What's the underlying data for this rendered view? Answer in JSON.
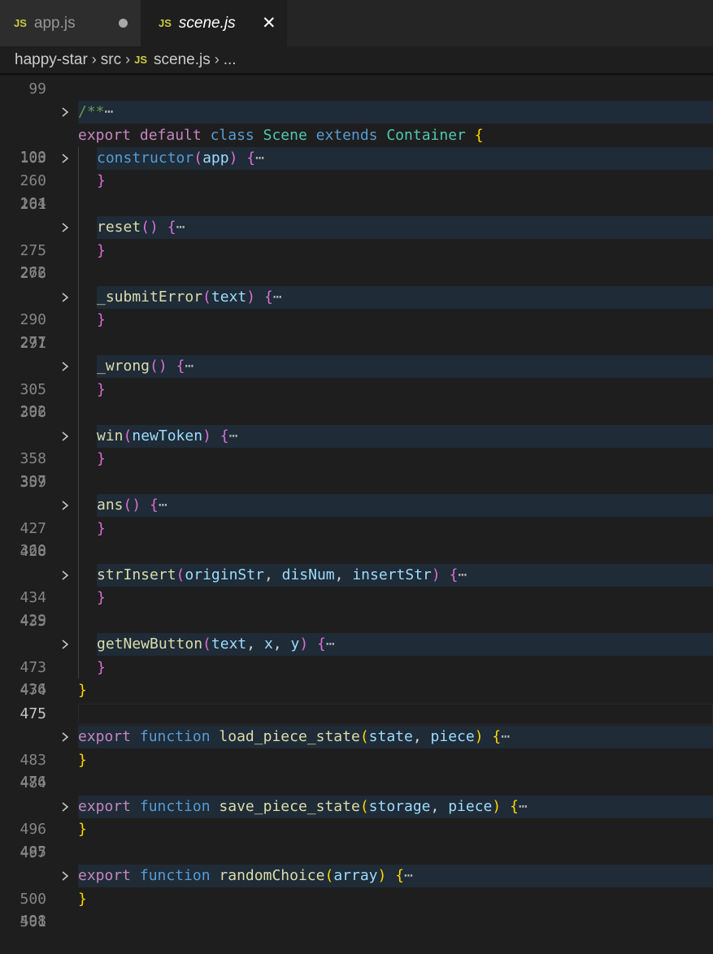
{
  "tabs": [
    {
      "icon": "JS",
      "label": "app.js",
      "active": false,
      "modified": true
    },
    {
      "icon": "JS",
      "label": "scene.js",
      "active": true,
      "close": "✕"
    }
  ],
  "breadcrumb": {
    "items": [
      "happy-star",
      "src",
      "scene.js",
      "..."
    ],
    "file_icon": "JS",
    "separator": "›"
  },
  "colors": {
    "keyword": "#c586c0",
    "storage": "#569cd6",
    "class": "#4ec9b0",
    "function": "#dcdcaa",
    "parameter": "#9cdcfe",
    "comment": "#6a9955",
    "fold_highlight": "#1f2b36"
  },
  "line_numbers": [
    "99",
    "100",
    "103",
    "104",
    "260",
    "261",
    "262",
    "275",
    "276",
    "277",
    "290",
    "291",
    "292",
    "305",
    "306",
    "307",
    "358",
    "359",
    "360",
    "427",
    "428",
    "429",
    "434",
    "435",
    "436",
    "473",
    "474",
    "475",
    "476",
    "483",
    "484",
    "485",
    "496",
    "497",
    "498",
    "500",
    "501"
  ],
  "code": {
    "l100": {
      "comment": "/**",
      "ellipsis": "⋯"
    },
    "l103": {
      "export": "export",
      "default": "default",
      "class": "class",
      "name": "Scene",
      "extends": "extends",
      "parent": "Container",
      "brace": "{"
    },
    "l104": {
      "name": "constructor",
      "open": "(",
      "params": [
        "app"
      ],
      "close": ")",
      "brace": "{",
      "ellipsis": "⋯"
    },
    "l260": {
      "brace": "}"
    },
    "l262": {
      "name": "reset",
      "open": "(",
      "close": ")",
      "brace": "{",
      "ellipsis": "⋯"
    },
    "l275": {
      "brace": "}"
    },
    "l277": {
      "name": "_submitError",
      "open": "(",
      "params": [
        "text"
      ],
      "close": ")",
      "brace": "{",
      "ellipsis": "⋯"
    },
    "l290": {
      "brace": "}"
    },
    "l292": {
      "name": "_wrong",
      "open": "(",
      "close": ")",
      "brace": "{",
      "ellipsis": "⋯"
    },
    "l305": {
      "brace": "}"
    },
    "l307": {
      "name": "win",
      "open": "(",
      "params": [
        "newToken"
      ],
      "close": ")",
      "brace": "{",
      "ellipsis": "⋯"
    },
    "l358": {
      "brace": "}"
    },
    "l360": {
      "name": "ans",
      "open": "(",
      "close": ")",
      "brace": "{",
      "ellipsis": "⋯"
    },
    "l427": {
      "brace": "}"
    },
    "l429": {
      "name": "strInsert",
      "open": "(",
      "params": [
        "originStr",
        "disNum",
        "insertStr"
      ],
      "comma": ",",
      "close": ")",
      "brace": "{",
      "ellipsis": "⋯"
    },
    "l434": {
      "brace": "}"
    },
    "l436": {
      "name": "getNewButton",
      "open": "(",
      "params": [
        "text",
        "x",
        "y"
      ],
      "comma": ",",
      "close": ")",
      "brace": "{",
      "ellipsis": "⋯"
    },
    "l473": {
      "brace": "}"
    },
    "l474": {
      "brace": "}"
    },
    "l476": {
      "export": "export",
      "function": "function",
      "name": "load_piece_state",
      "open": "(",
      "params": [
        "state",
        "piece"
      ],
      "comma": ",",
      "close": ")",
      "brace": "{",
      "ellipsis": "⋯"
    },
    "l483": {
      "brace": "}"
    },
    "l485": {
      "export": "export",
      "function": "function",
      "name": "save_piece_state",
      "open": "(",
      "params": [
        "storage",
        "piece"
      ],
      "comma": ",",
      "close": ")",
      "brace": "{",
      "ellipsis": "⋯"
    },
    "l496": {
      "brace": "}"
    },
    "l498": {
      "export": "export",
      "function": "function",
      "name": "randomChoice",
      "open": "(",
      "params": [
        "array"
      ],
      "close": ")",
      "brace": "{",
      "ellipsis": "⋯"
    },
    "l500": {
      "brace": "}"
    }
  }
}
